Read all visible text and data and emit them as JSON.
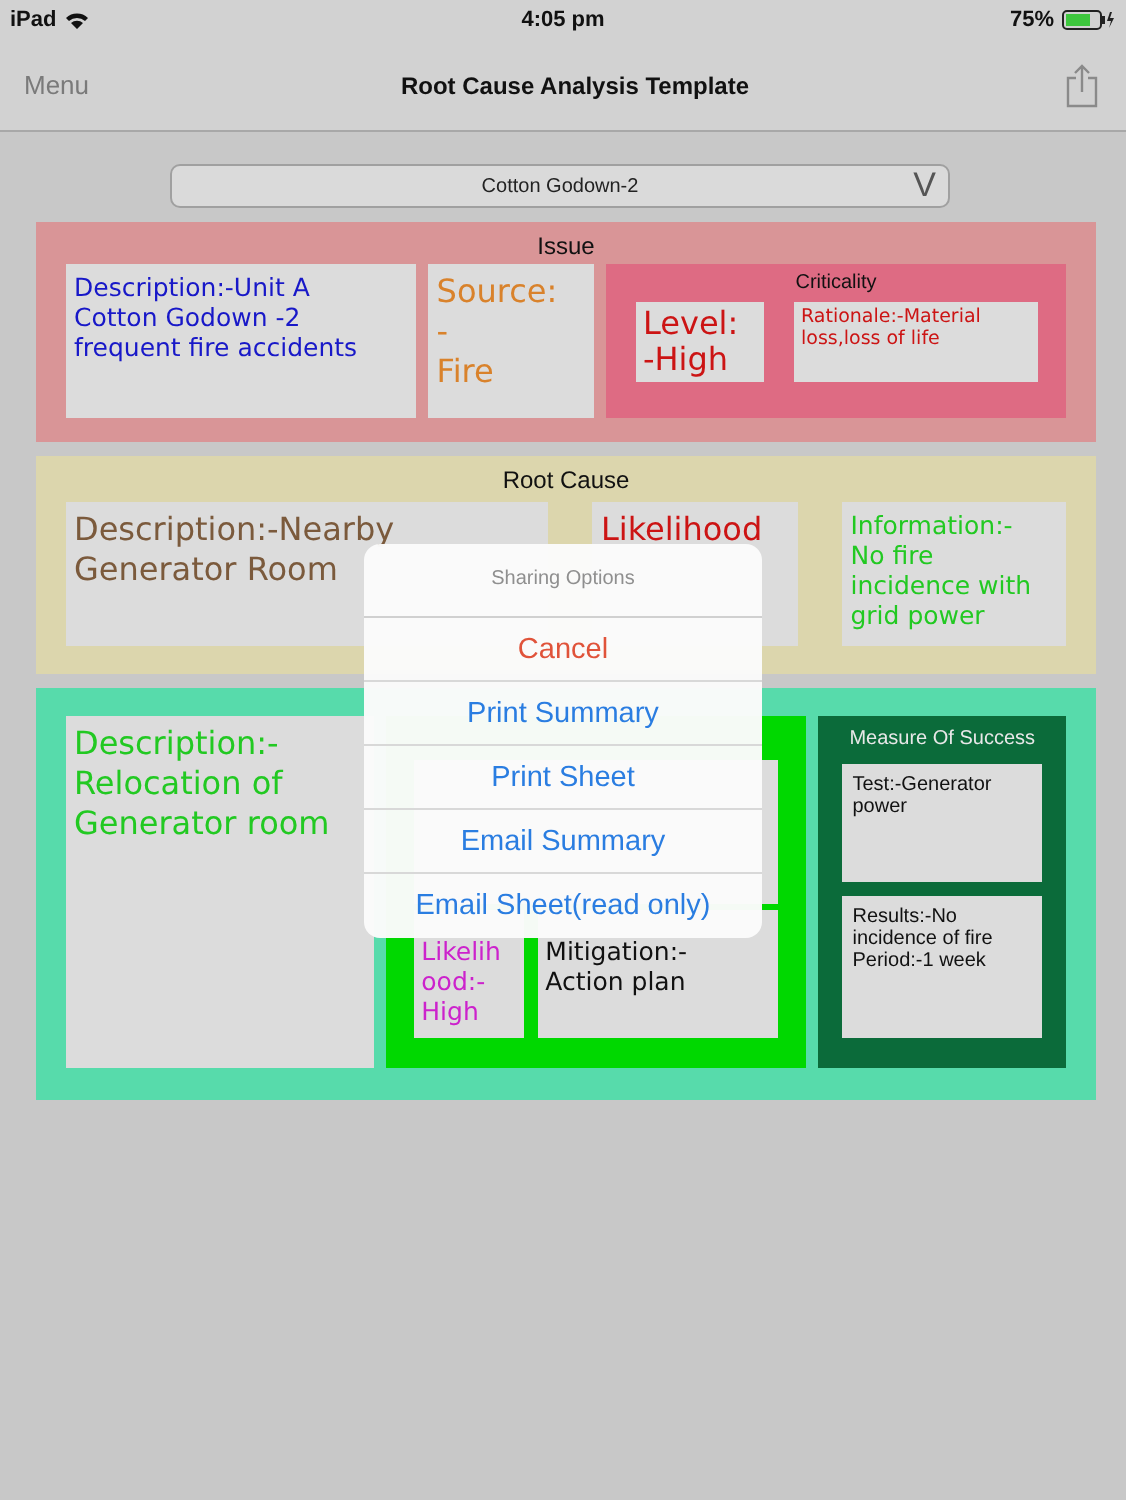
{
  "status_bar": {
    "carrier": "iPad",
    "time": "4:05 pm",
    "battery": "75%"
  },
  "nav_bar": {
    "menu": "Menu",
    "title": "Root Cause Analysis Template"
  },
  "selector": {
    "value": "Cotton Godown-2",
    "caret": "V"
  },
  "issue": {
    "title": "Issue",
    "description": [
      "Description:-Unit A",
      "Cotton Godown -2",
      "frequent fire accidents"
    ],
    "source": [
      "Source:",
      "-",
      "Fire"
    ],
    "criticality": {
      "title": "Criticality",
      "level": [
        "Level:",
        "-High"
      ],
      "rationale": [
        "Rationale:-Material",
        "loss,loss of life"
      ]
    }
  },
  "root_cause": {
    "title": "Root Cause",
    "description": [
      "Description:-Nearby",
      "Generator Room"
    ],
    "likelihood": [
      "Likelihood"
    ],
    "information": [
      "Information:-",
      "No fire",
      "incidence with",
      "grid power"
    ]
  },
  "solution": {
    "description": [
      "Description:-",
      "Relocation of",
      "Generator room"
    ],
    "likelihood": [
      "Likelih",
      "ood:-",
      "High"
    ],
    "mitigation": [
      "Mitigation:-",
      "Action plan"
    ],
    "measure": {
      "title": "Measure Of Success",
      "test": [
        "Test:-Generator",
        "power"
      ],
      "results": [
        "Results:-No",
        "incidence of fire",
        "Period:-1 week"
      ]
    }
  },
  "popup": {
    "title": "Sharing Options",
    "actions": [
      {
        "label": "Cancel",
        "kind": "cancel"
      },
      {
        "label": "Print Summary",
        "kind": "default"
      },
      {
        "label": "Print Sheet",
        "kind": "default"
      },
      {
        "label": "Email Summary",
        "kind": "default"
      },
      {
        "label": "Email Sheet(read only)",
        "kind": "default"
      }
    ]
  }
}
